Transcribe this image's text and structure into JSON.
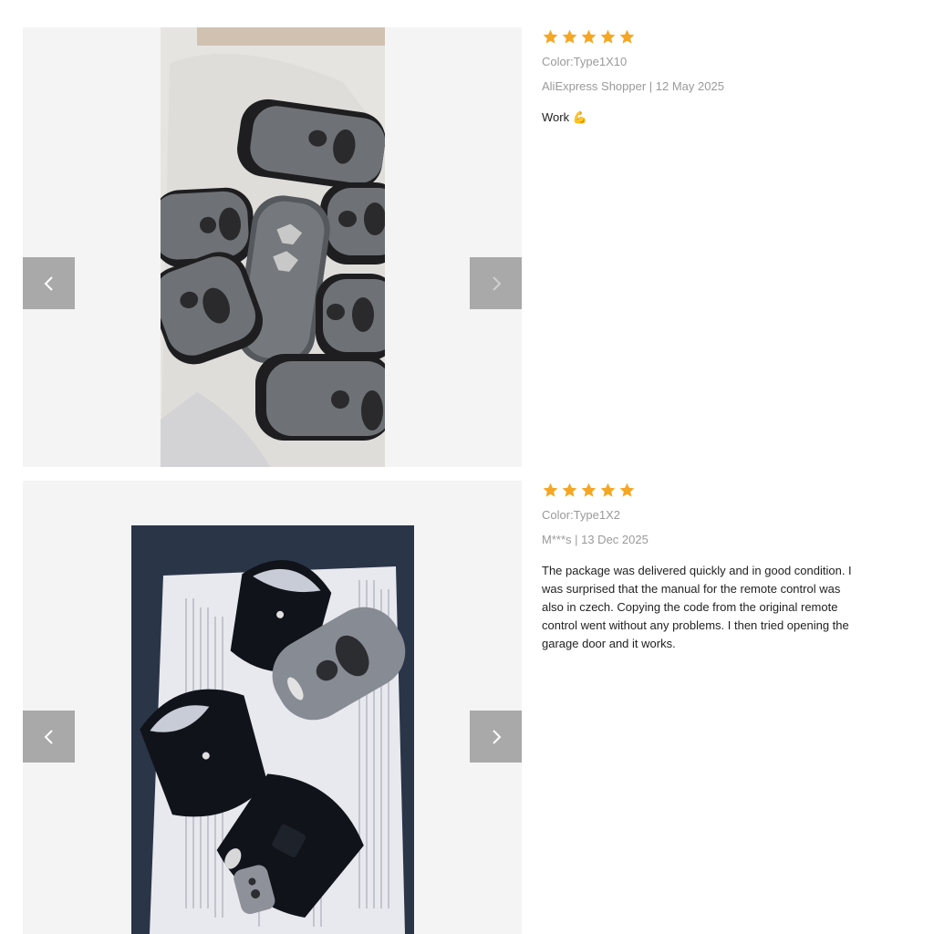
{
  "reviews": [
    {
      "rating": 5,
      "color_variant": "Color:Type1X10",
      "author_date": "AliExpress Shopper | 12 May 2025",
      "text": "Work 💪",
      "photo_description": "pile of grey two-button garage door remote controls in plastic bag",
      "prev_enabled": true,
      "next_enabled": false
    },
    {
      "rating": 5,
      "color_variant": "Color:Type1X2",
      "author_date": "M***s | 13 Dec 2025",
      "text": "The package was delivered quickly and in good condition. I was surprised that the manual for the remote control was also in czech. Copying the code from the original remote control went without any problems. I then tried opening the garage door and it works.",
      "photo_description": "remote controls lying on printed manual",
      "prev_enabled": true,
      "next_enabled": true
    }
  ],
  "icons": {
    "star": "star-icon",
    "prev": "chevron-left-icon",
    "next": "chevron-right-icon"
  },
  "colors": {
    "star": "#f5a623",
    "nav_button": "#a9a9a9",
    "gallery_bg": "#f4f4f4",
    "meta_text": "#9a9a9a"
  }
}
